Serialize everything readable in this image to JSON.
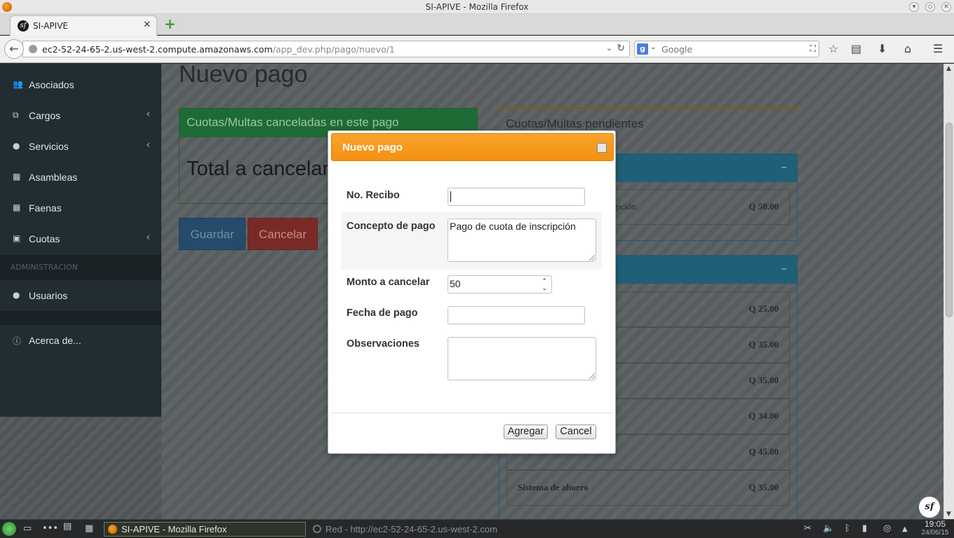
{
  "window": {
    "title": "SI-APIVE - Mozilla Firefox"
  },
  "browser": {
    "tab_label": "SI-APIVE",
    "url_host": "ec2-52-24-65-2.us-west-2.compute.amazonaws.com",
    "url_path": "/app_dev.php/pago/nuevo/1",
    "search_placeholder": "Google"
  },
  "sidebar": {
    "items": [
      {
        "label": "Asociados",
        "icon": "users-icon"
      },
      {
        "label": "Cargos",
        "icon": "sitemap-icon"
      },
      {
        "label": "Servicios",
        "icon": "drop-icon"
      },
      {
        "label": "Asambleas",
        "icon": "calendar-icon"
      },
      {
        "label": "Faenas",
        "icon": "calendar-icon"
      },
      {
        "label": "Cuotas",
        "icon": "money-icon"
      }
    ],
    "section_header": "ADMINISTRACIÓN",
    "admin_items": [
      {
        "label": "Usuarios",
        "icon": "user-icon"
      }
    ],
    "about_label": "Acerca de..."
  },
  "main": {
    "page_title": "Nuevo pago",
    "left_box_title": "Cuotas/Multas canceladas en este pago",
    "total_label": "Total a cancelar:",
    "guardar_label": "Guardar",
    "cancelar_label": "Cancelar",
    "right_title": "Cuotas/Multas pendientes",
    "box1_row_label_visible": "pción",
    "box1_row_amount": "Q 50.00",
    "box2_first_row_visible": "5",
    "box2_amounts": [
      "Q 25.00",
      "Q 35.00",
      "Q 35.00",
      "Q 34.00",
      "Q 45.00",
      "Q 35.00"
    ],
    "box2_last_row_label": "Sistema de ahorro",
    "minimize_symbol": "–"
  },
  "modal": {
    "title": "Nuevo pago",
    "fields": {
      "recibo_label": "No. Recibo",
      "recibo_value": "",
      "concepto_label": "Concepto de pago",
      "concepto_value": "Pago de cuota de inscripción",
      "monto_label": "Monto a cancelar",
      "monto_value": "50",
      "fecha_label": "Fecha de pago",
      "fecha_value": "",
      "observaciones_label": "Observaciones",
      "observaciones_value": ""
    },
    "agregar_label": "Agregar",
    "cancel_label": "Cancel"
  },
  "taskbar": {
    "active_task": "SI-APIVE - Mozilla Firefox",
    "inactive_task": "Red - http://ec2-52-24-65-2.us-west-2.com",
    "time": "19:05",
    "date": "24/06/15"
  },
  "colors": {
    "sidebar_bg": "#222d32",
    "modal_header": "#f39112",
    "left_box_header": "#1e6b35",
    "right_box_header": "#1f5f77"
  }
}
